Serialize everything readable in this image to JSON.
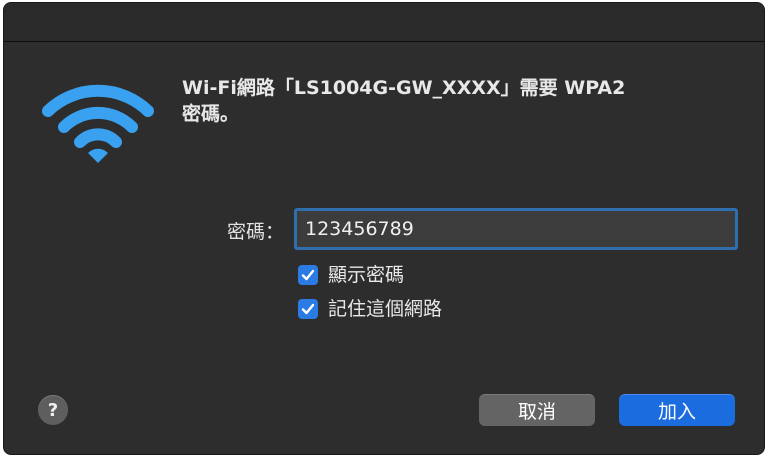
{
  "dialog": {
    "message_line1": "Wi-Fi網路「LS1004G-GW_XXXX」需要 WPA2",
    "message_line2": "密碼。"
  },
  "form": {
    "password_label": "密碼：",
    "password_value": "123456789",
    "show_password_label": "顯示密碼",
    "show_password_checked": true,
    "remember_network_label": "記住這個網路",
    "remember_network_checked": true
  },
  "buttons": {
    "help_symbol": "?",
    "cancel_label": "取消",
    "join_label": "加入"
  },
  "colors": {
    "dialog_bg": "#2d2d2d",
    "wifi_icon": "#3aa0f0",
    "accent": "#1a6cdf",
    "checkbox": "#2b7be5"
  },
  "icons": {
    "wifi": "wifi-icon",
    "help": "help-icon",
    "check": "checkmark-icon"
  }
}
